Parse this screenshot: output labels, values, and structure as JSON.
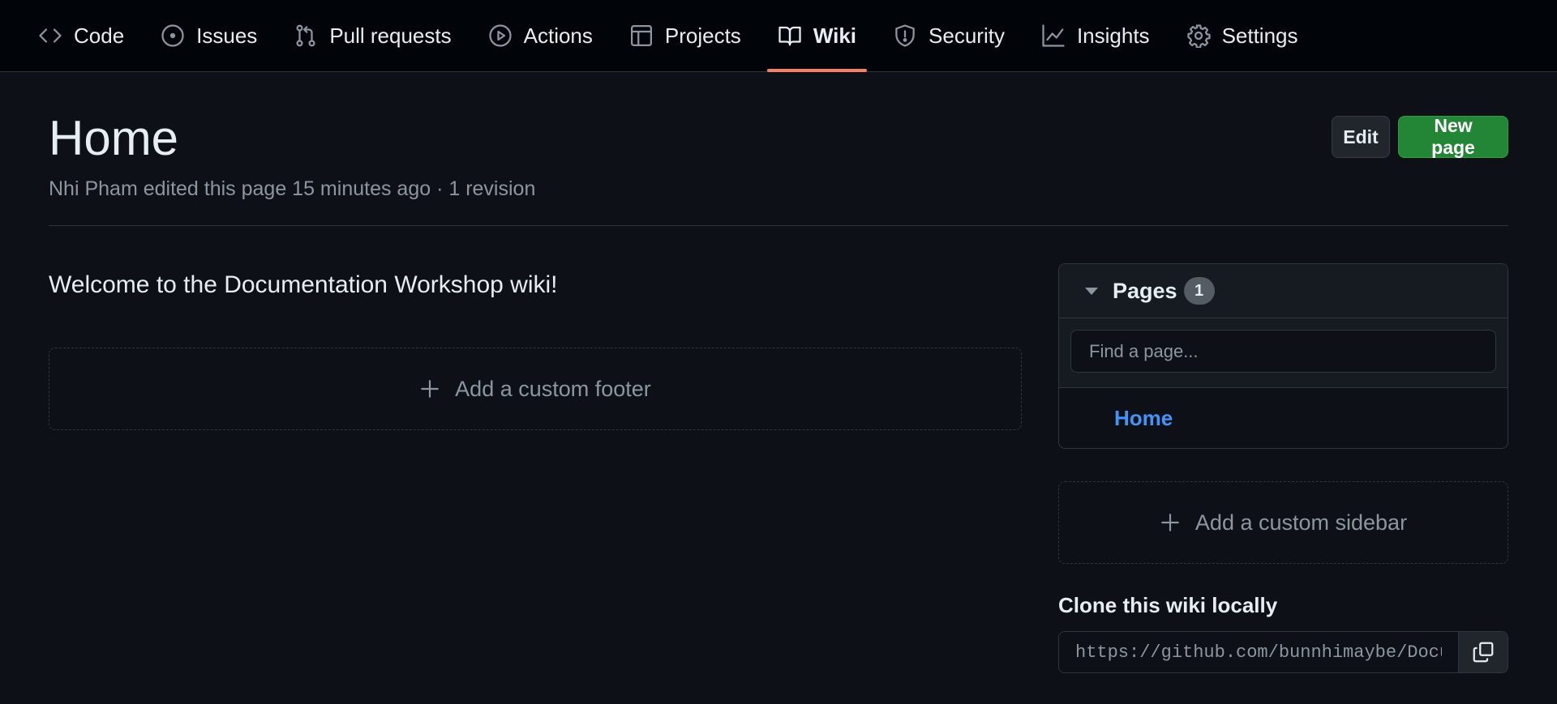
{
  "nav": {
    "tabs": [
      {
        "label": "Code",
        "icon": "code-icon"
      },
      {
        "label": "Issues",
        "icon": "issue-icon"
      },
      {
        "label": "Pull requests",
        "icon": "pull-request-icon"
      },
      {
        "label": "Actions",
        "icon": "play-icon"
      },
      {
        "label": "Projects",
        "icon": "table-icon"
      },
      {
        "label": "Wiki",
        "icon": "book-icon",
        "active": true
      },
      {
        "label": "Security",
        "icon": "shield-icon"
      },
      {
        "label": "Insights",
        "icon": "graph-icon"
      },
      {
        "label": "Settings",
        "icon": "gear-icon"
      }
    ],
    "active_underline_color": "#f78166"
  },
  "header": {
    "title": "Home",
    "meta": "Nhi Pham edited this page 15 minutes ago · 1 revision",
    "edit_label": "Edit",
    "new_page_label": "New page"
  },
  "main": {
    "welcome": "Welcome to the Documentation Workshop wiki!",
    "add_footer_label": "Add a custom footer"
  },
  "sidebar": {
    "pages_title": "Pages",
    "pages_count": "1",
    "search_placeholder": "Find a page...",
    "pages": [
      "Home"
    ],
    "add_sidebar_label": "Add a custom sidebar",
    "clone_title": "Clone this wiki locally",
    "clone_url": "https://github.com/bunnhimaybe/Documentation-Workshop.wiki.git"
  },
  "colors": {
    "background": "#0d1117",
    "nav_background": "#010409",
    "primary_button": "#238636",
    "link": "#4493f8"
  }
}
